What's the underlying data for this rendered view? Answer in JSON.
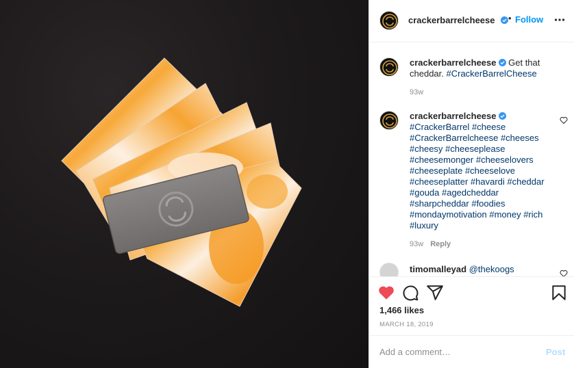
{
  "photo": {
    "alt_subject": "cheese-slices-with-brand-tag"
  },
  "account": {
    "username": "crackerbarrelcheese",
    "separator": "•",
    "follow_label": "Follow"
  },
  "caption": {
    "username": "crackerbarrelcheese",
    "text": "Get that cheddar.",
    "hashtag": "#CrackerBarrelCheese",
    "time": "93w"
  },
  "comments": [
    {
      "username": "crackerbarrelcheese",
      "lines": [
        "#CrackerBarrel #cheese",
        "#CrackerBarrelcheese #cheeses",
        "#cheesy #cheeseplease",
        "#cheesemonger #cheeselovers",
        "#cheeseplate #cheeselove",
        "#cheeseplatter #havardi #cheddar",
        "#gouda #agedcheddar",
        "#sharpcheddar #foodies",
        "#mondaymotivation #money #rich",
        "#luxury"
      ],
      "time": "93w",
      "reply_label": "Reply"
    },
    {
      "username": "timomalleyad",
      "text": "@thekoogs"
    }
  ],
  "stats": {
    "likes": "1,466 likes",
    "date": "MARCH 18, 2019"
  },
  "add_comment": {
    "placeholder": "Add a comment…",
    "post_label": "Post"
  },
  "icons": {
    "like": "heart-filled-icon",
    "comment": "speech-bubble-icon",
    "share": "paper-plane-icon",
    "save": "bookmark-icon",
    "more": "ellipsis-icon",
    "verified": "verified-badge-icon"
  },
  "colors": {
    "heart": "#ed4956",
    "follow": "#0095f6",
    "link": "#00376b",
    "muted": "#8e8e8e",
    "post_disabled": "#b2dffc"
  }
}
